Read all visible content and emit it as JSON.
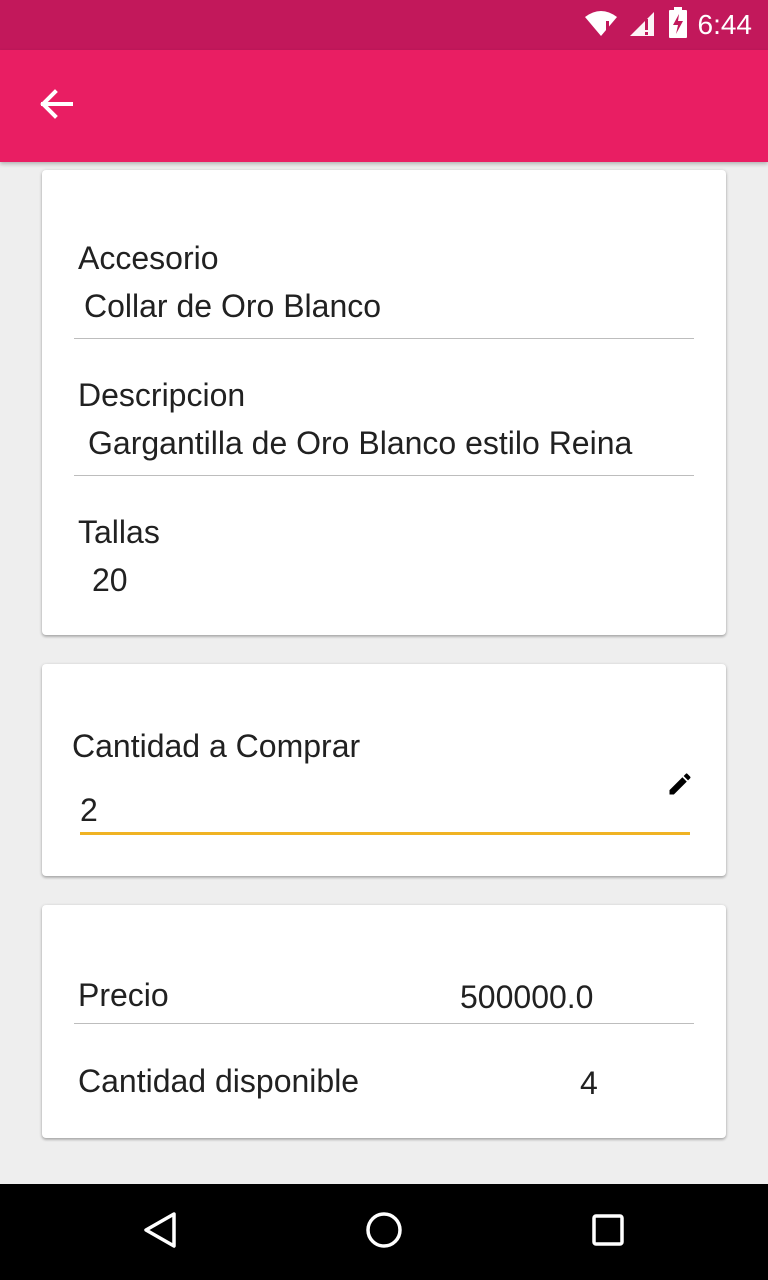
{
  "status_bar": {
    "time": "6:44"
  },
  "product": {
    "accessory_label": "Accesorio",
    "accessory_value": "Collar de Oro Blanco",
    "description_label": "Descripcion",
    "description_value": "Gargantilla de Oro Blanco estilo Reina",
    "sizes_label": "Tallas",
    "sizes_value": "20"
  },
  "purchase": {
    "quantity_label": "Cantidad a Comprar",
    "quantity_value": "2"
  },
  "pricing": {
    "price_label": "Precio",
    "price_value": "500000.0",
    "available_label": "Cantidad disponible",
    "available_value": "4"
  },
  "colors": {
    "status_bar": "#c2185b",
    "app_bar": "#e91e63",
    "accent": "#f0b323"
  },
  "icons": {
    "back": "arrow-back-icon",
    "edit": "pencil-icon",
    "wifi": "wifi-icon",
    "signal": "signal-icon",
    "battery": "battery-charging-icon",
    "nav_back": "triangle-back-icon",
    "nav_home": "circle-home-icon",
    "nav_recents": "square-recents-icon"
  }
}
